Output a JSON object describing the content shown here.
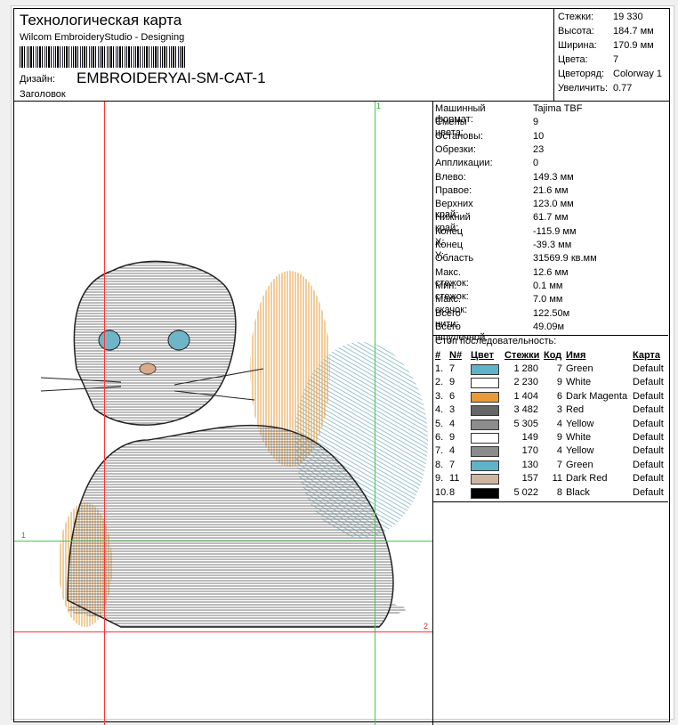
{
  "header": {
    "title": "Технологическая карта",
    "subtitle": "Wilcom EmbroideryStudio - Designing",
    "design_label": "Дизайн:",
    "design_value": "EMBROIDERYAI-SM-CAT-1",
    "heading_label": "Заголовок"
  },
  "stats": [
    {
      "k": "Стежки:",
      "v": "19 330"
    },
    {
      "k": "Высота:",
      "v": "184.7 мм"
    },
    {
      "k": "Ширина:",
      "v": "170.9 мм"
    },
    {
      "k": "Цвета:",
      "v": "7"
    },
    {
      "k": "Цветоряд:",
      "v": "Colorway 1"
    },
    {
      "k": "Увеличить:",
      "v": "0.77"
    }
  ],
  "machine": [
    {
      "k": "Машинный формат:",
      "v": "Tajima TBF"
    },
    {
      "k": "Смены цвета:",
      "v": "9"
    },
    {
      "k": "Остановы:",
      "v": "10"
    },
    {
      "k": "Обрезки:",
      "v": "23"
    },
    {
      "k": "Аппликации:",
      "v": "0"
    },
    {
      "k": "Влево:",
      "v": "149.3 мм"
    },
    {
      "k": "Правое:",
      "v": "21.6 мм"
    },
    {
      "k": "Верхних край:",
      "v": "123.0 мм"
    },
    {
      "k": "Нижний край:",
      "v": "61.7 мм"
    },
    {
      "k": "Конец X:",
      "v": "-115.9 мм"
    },
    {
      "k": "Конец Y:",
      "v": "-39.3 мм"
    },
    {
      "k": "Область",
      "v": "31569.9 кв.мм"
    },
    {
      "k": "Макс. стежок:",
      "v": "12.6 мм"
    },
    {
      "k": "Мин. стежок:",
      "v": "0.1 мм"
    },
    {
      "k": "Макс. скачок:",
      "v": "7.0 мм"
    },
    {
      "k": "Всего нити:",
      "v": "122.50м"
    },
    {
      "k": "Всего шпулечной:",
      "v": "49.09м"
    }
  ],
  "sequence": {
    "title": "Стоп последовательность:",
    "headers": {
      "num": "#",
      "n": "N#",
      "color": "Цвет",
      "stitches": "Стежки",
      "code": "Код",
      "name": "Имя",
      "chart": "Карта"
    },
    "rows": [
      {
        "num": "1.",
        "n": "7",
        "color": "#5fb3c8",
        "stitches": "1 280",
        "code": "7",
        "name": "Green",
        "chart": "Default"
      },
      {
        "num": "2.",
        "n": "9",
        "color": "#ffffff",
        "stitches": "2 230",
        "code": "9",
        "name": "White",
        "chart": "Default"
      },
      {
        "num": "3.",
        "n": "6",
        "color": "#e89a38",
        "stitches": "1 404",
        "code": "6",
        "name": "Dark Magenta",
        "chart": "Default"
      },
      {
        "num": "4.",
        "n": "3",
        "color": "#666666",
        "stitches": "3 482",
        "code": "3",
        "name": "Red",
        "chart": "Default"
      },
      {
        "num": "5.",
        "n": "4",
        "color": "#8c8c8c",
        "stitches": "5 305",
        "code": "4",
        "name": "Yellow",
        "chart": "Default"
      },
      {
        "num": "6.",
        "n": "9",
        "color": "#ffffff",
        "stitches": "149",
        "code": "9",
        "name": "White",
        "chart": "Default"
      },
      {
        "num": "7.",
        "n": "4",
        "color": "#8c8c8c",
        "stitches": "170",
        "code": "4",
        "name": "Yellow",
        "chart": "Default"
      },
      {
        "num": "8.",
        "n": "7",
        "color": "#5fb3c8",
        "stitches": "130",
        "code": "7",
        "name": "Green",
        "chart": "Default"
      },
      {
        "num": "9.",
        "n": "11",
        "color": "#cdb5a0",
        "stitches": "157",
        "code": "11",
        "name": "Dark Red",
        "chart": "Default"
      },
      {
        "num": "10.",
        "n": "8",
        "color": "#000000",
        "stitches": "5 022",
        "code": "8",
        "name": "Black",
        "chart": "Default"
      }
    ]
  },
  "guides": {
    "v1": "1",
    "h1": "1",
    "h2": "2"
  }
}
